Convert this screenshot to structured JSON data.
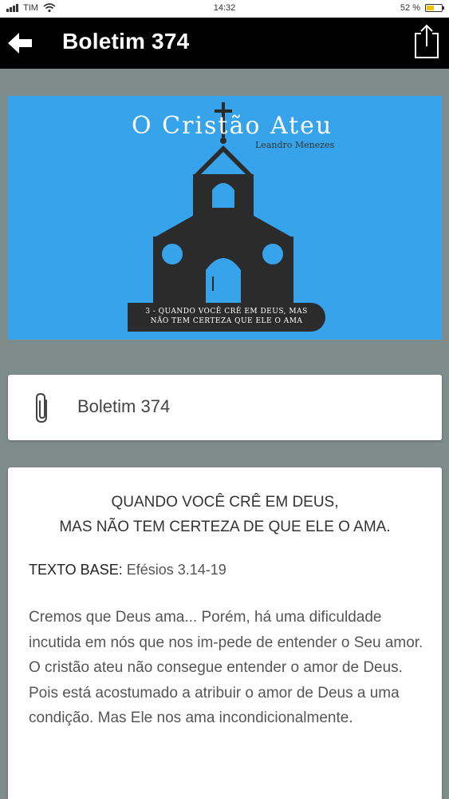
{
  "status_bar": {
    "carrier": "TIM",
    "time": "14:32",
    "battery": "52 %",
    "battery_level": 0.52,
    "icons": [
      "signal-icon",
      "wifi-icon",
      "battery-icon"
    ]
  },
  "app_bar": {
    "title": "Boletim 374",
    "icons": [
      "back-arrow-icon",
      "share-icon"
    ]
  },
  "banner": {
    "title": "O Cristão Ateu",
    "author": "Leandro Menezes",
    "ribbon_line1": "3 - QUANDO VOCÊ CRÊ EM DEUS, MAS",
    "ribbon_line2": "NÃO TEM CERTEZA QUE ELE O AMA",
    "background_color": "#36a3ea"
  },
  "attachment": {
    "icon": "paperclip-icon",
    "label": "Boletim 374"
  },
  "content": {
    "heading_line1": "QUANDO VOCÊ CRÊ EM DEUS,",
    "heading_line2": "MAS NÃO TEM CERTEZA DE QUE ELE O AMA.",
    "texto_base_label": "TEXTO BASE:",
    "texto_base_ref": "Efésios 3.14-19",
    "paragraph1": "Cremos que Deus ama... Porém, há uma dificuldade incutida em nós que nos im-pede de entender o Seu amor.",
    "paragraph2": "O cristão ateu não consegue entender o amor de Deus. Pois está acostumado a atribuir o amor de Deus a uma condição. Mas Ele nos ama incondicionalmente."
  }
}
